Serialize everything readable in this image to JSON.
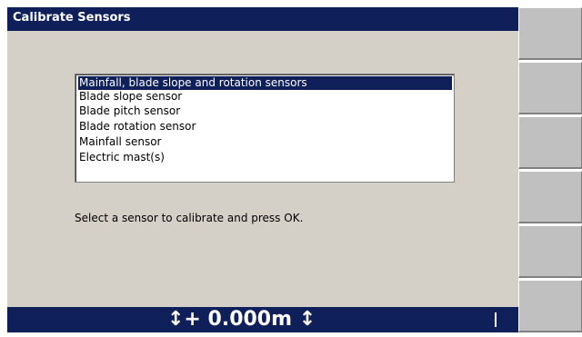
{
  "window": {
    "title": "Calibrate Sensors"
  },
  "sensor_list": {
    "items": [
      {
        "label": "Mainfall, blade slope and rotation sensors",
        "selected": true
      },
      {
        "label": "Blade slope sensor",
        "selected": false
      },
      {
        "label": "Blade pitch sensor",
        "selected": false
      },
      {
        "label": "Blade rotation sensor",
        "selected": false
      },
      {
        "label": "Mainfall sensor",
        "selected": false
      },
      {
        "label": "Electric mast(s)",
        "selected": false
      }
    ]
  },
  "prompt": "Select a sensor to calibrate and press OK.",
  "status_bar": {
    "elevation": "↕+ 0.000m ↕"
  },
  "softkeys": {
    "count": 6
  },
  "colors": {
    "title_bar": "#0f1f5a",
    "background": "#d4d0c8",
    "selection": "#0f1f5a",
    "softkey": "#c0c0c0"
  }
}
